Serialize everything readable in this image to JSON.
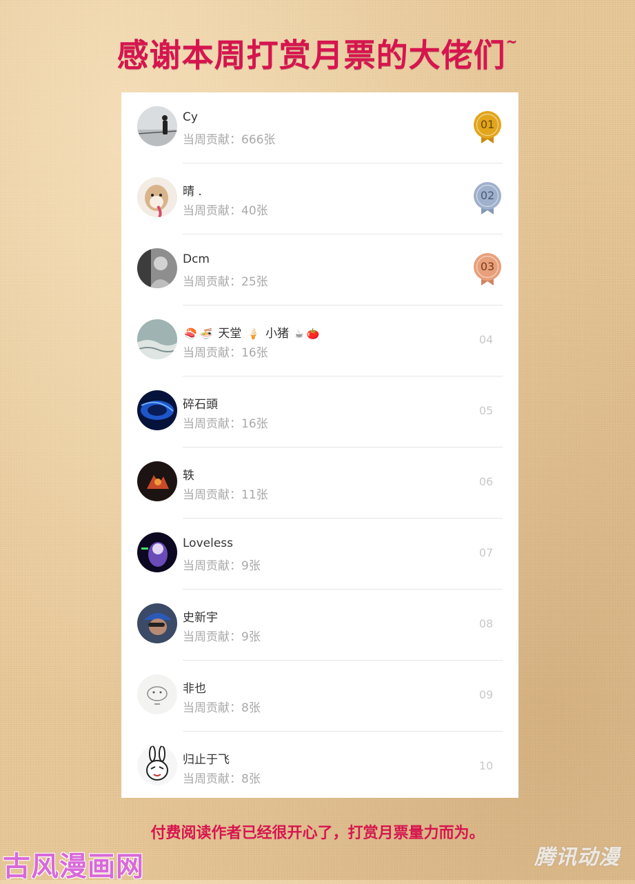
{
  "header": {
    "title": "感谢本周打赏月票的大佬们",
    "title_suffix": "~"
  },
  "ranking": {
    "contribution_label": "当周贡献：",
    "unit": "张",
    "rows": [
      {
        "name": "Cy",
        "count": "666",
        "rank": "01",
        "medal": "gold",
        "avatar": "photo-person-by-railing"
      },
      {
        "name": "晴 .",
        "count": "40",
        "rank": "02",
        "medal": "silver",
        "avatar": "photo-shiba-dog"
      },
      {
        "name": "Dcm",
        "count": "25",
        "rank": "03",
        "medal": "bronze",
        "avatar": "photo-bw-portrait"
      },
      {
        "name_parts": [
          "🍣",
          "🍜",
          "天堂",
          "🍦",
          "小猪",
          "☕",
          "🍅"
        ],
        "count": "16",
        "rank": "04",
        "avatar": "photo-sea-waves"
      },
      {
        "name": "碎石頭",
        "count": "16",
        "rank": "05",
        "avatar": "blue-galaxy"
      },
      {
        "name": "轶",
        "count": "11",
        "rank": "06",
        "avatar": "dark-fire-art"
      },
      {
        "name": "Loveless",
        "count": "9",
        "rank": "07",
        "avatar": "anime-purple"
      },
      {
        "name": "史新宇",
        "count": "9",
        "rank": "08",
        "avatar": "photo-person-cap"
      },
      {
        "name": "非也",
        "count": "8",
        "rank": "09",
        "avatar": "hamster-sketch"
      },
      {
        "name": "归止于飞",
        "count": "8",
        "rank": "10",
        "avatar": "rabbit-cartoon"
      }
    ]
  },
  "footer": {
    "text": "付费阅读作者已经很开心了，打赏月票量力而为。"
  },
  "watermarks": {
    "left": "古风漫画网",
    "right": "腾讯动漫"
  },
  "colors": {
    "title": "#d6154f",
    "gold": "#e2a51c",
    "silver": "#9fb0cc",
    "bronze": "#e8a07a",
    "rank_gray": "#c8c8c8"
  }
}
